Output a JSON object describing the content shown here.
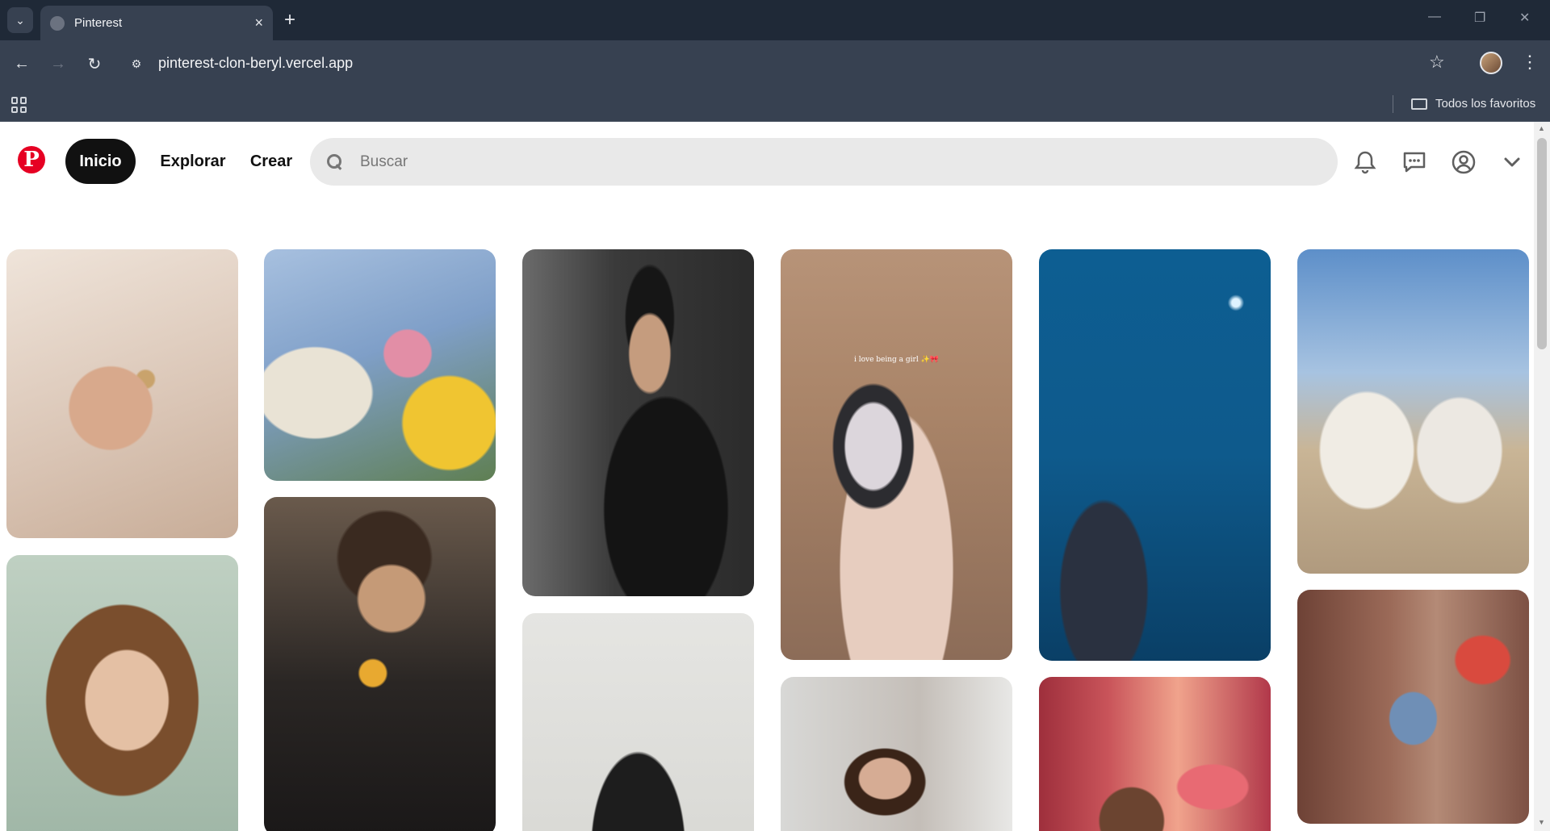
{
  "browser": {
    "tab_title": "Pinterest",
    "new_tab": "+",
    "url": "pinterest-clon-beryl.vercel.app",
    "bookmarks_folder": "Todos los favoritos"
  },
  "header": {
    "logo": "P",
    "nav": {
      "home": "Inicio",
      "explore": "Explorar",
      "create": "Crear"
    },
    "search_placeholder": "Buscar",
    "icons": [
      "bell-icon",
      "messages-icon",
      "profile-icon",
      "chevron-down-icon"
    ]
  },
  "pins": [
    {
      "id": "necklaces-hand",
      "column": 1,
      "colors": [
        "#e8d9cf",
        "#c9a36c",
        "#b8322b"
      ]
    },
    {
      "id": "woman-curly-hair",
      "column": 1,
      "colors": [
        "#8b6a4a",
        "#4a2e1d",
        "#d7b49a"
      ]
    },
    {
      "id": "flower-market",
      "column": 2,
      "colors": [
        "#9fb8d8",
        "#e8c43a",
        "#d98aa0"
      ]
    },
    {
      "id": "man-drinking-sunglasses",
      "column": 2,
      "colors": [
        "#2e2a28",
        "#6b5443",
        "#c9a27d"
      ]
    },
    {
      "id": "smiling-man-black-shirt",
      "column": 3,
      "colors": [
        "#3c3c3c",
        "#1c1c1c",
        "#b08a6e"
      ]
    },
    {
      "id": "man-dark-hair-portrait",
      "column": 3,
      "colors": [
        "#e2e2e0",
        "#d4d4d0",
        "#222"
      ]
    },
    {
      "id": "vanity-tablet-makeup",
      "column": 4,
      "colors": [
        "#c7a68a",
        "#6e5848",
        "#e0c4b2"
      ],
      "caption": "i love being a girl ✨🎀"
    },
    {
      "id": "woman-office-portrait",
      "column": 4,
      "colors": [
        "#cfcfcf",
        "#a8a19a",
        "#1e1e1e"
      ]
    },
    {
      "id": "princess-starry-night",
      "column": 5,
      "colors": [
        "#0a4f7c",
        "#1a6fa3",
        "#0d3c5e"
      ]
    },
    {
      "id": "princess-cartoon-curtains",
      "column": 5,
      "colors": [
        "#b8434e",
        "#6f2e3f",
        "#e58a75"
      ]
    },
    {
      "id": "couple-camera-industrial",
      "column": 6,
      "colors": [
        "#7ba6d6",
        "#d9d0c2",
        "#5b4a3c"
      ]
    },
    {
      "id": "friends-doorway-scene",
      "column": 6,
      "colors": [
        "#7a4e3e",
        "#a77b68",
        "#3b3b4e"
      ]
    }
  ]
}
